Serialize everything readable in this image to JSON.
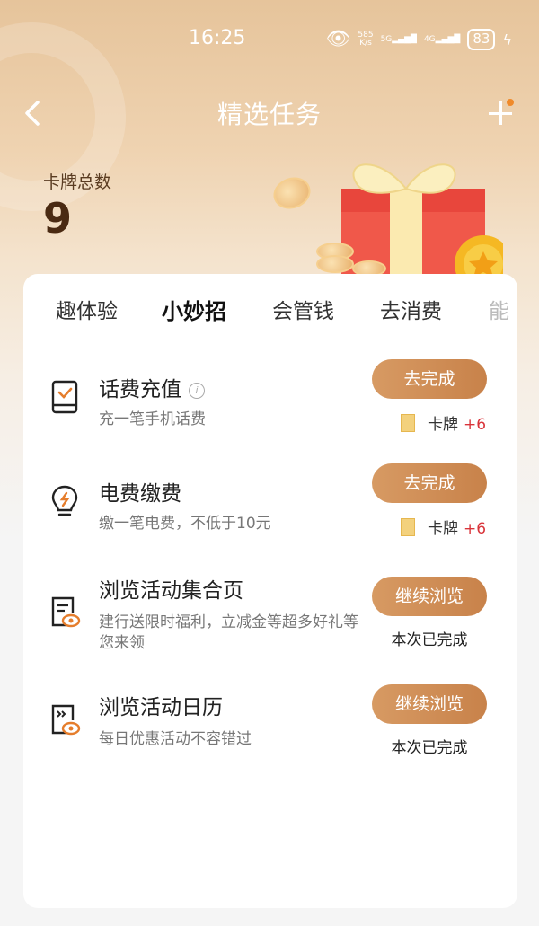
{
  "status_bar": {
    "time": "16:25",
    "speed_value": "585",
    "speed_unit": "K/s",
    "network_1": "5G",
    "network_2": "4G",
    "battery": "83"
  },
  "header": {
    "title": "精选任务",
    "back_icon": "chevron-left-icon",
    "add_icon": "plus-icon"
  },
  "cards": {
    "label": "卡牌总数",
    "count": "9"
  },
  "tabs": [
    {
      "label": "趣体验"
    },
    {
      "label": "小妙招"
    },
    {
      "label": "会管钱"
    },
    {
      "label": "去消费"
    },
    {
      "label": "能"
    }
  ],
  "active_tab": "小妙招",
  "tasks": [
    {
      "name": "话费充值",
      "desc": "充一笔手机话费",
      "icon": "phone-recharge-icon",
      "button": "去完成",
      "reward_label": "卡牌",
      "reward_value": "+6"
    },
    {
      "name": "电费缴费",
      "desc": "缴一笔电费，不低于10元",
      "icon": "lightbulb-icon",
      "button": "去完成",
      "reward_label": "卡牌",
      "reward_value": "+6"
    },
    {
      "name": "浏览活动集合页",
      "desc": "建行送限时福利，立减金等超多好礼等您来领",
      "icon": "document-eye-icon",
      "button": "继续浏览",
      "status": "本次已完成"
    },
    {
      "name": "浏览活动日历",
      "desc": "每日优惠活动不容错过",
      "icon": "calendar-eye-icon",
      "button": "继续浏览",
      "status": "本次已完成"
    }
  ],
  "colors": {
    "accent": "#cf8c54",
    "reward": "#d9343a",
    "header_bg": "#e6c49b"
  }
}
